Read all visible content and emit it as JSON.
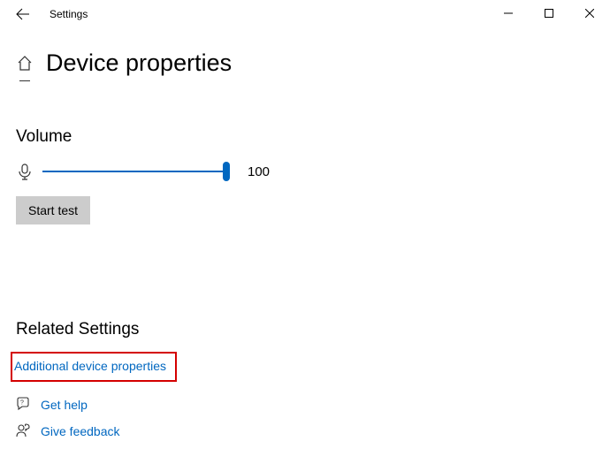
{
  "titlebar": {
    "title": "Settings"
  },
  "page": {
    "title": "Device properties"
  },
  "volume": {
    "label": "Volume",
    "value": "100",
    "start_test_label": "Start test"
  },
  "related": {
    "title": "Related Settings",
    "additional_link": "Additional device properties"
  },
  "footer": {
    "get_help": "Get help",
    "give_feedback": "Give feedback"
  }
}
